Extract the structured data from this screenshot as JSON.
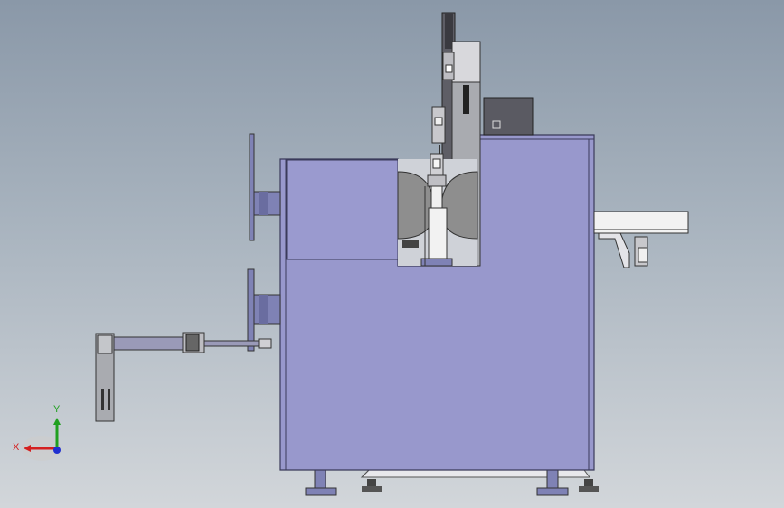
{
  "viewport": {
    "background_top": "#8a98a8",
    "background_bottom": "#d2d6da"
  },
  "colors": {
    "body": "#9898cc",
    "body_stroke": "#3a3a5a",
    "steel": "#a9abb0",
    "steel_dark": "#6e7076",
    "roller": "#8e8e8e",
    "panel_white": "#f2f2f2",
    "rod": "#9a9ab8",
    "block_dark": "#5a5a62"
  },
  "triad": {
    "x_label": "X",
    "y_label": "Y",
    "x_color": "#d42020",
    "y_color": "#20a020",
    "z_color": "#2030d0"
  }
}
